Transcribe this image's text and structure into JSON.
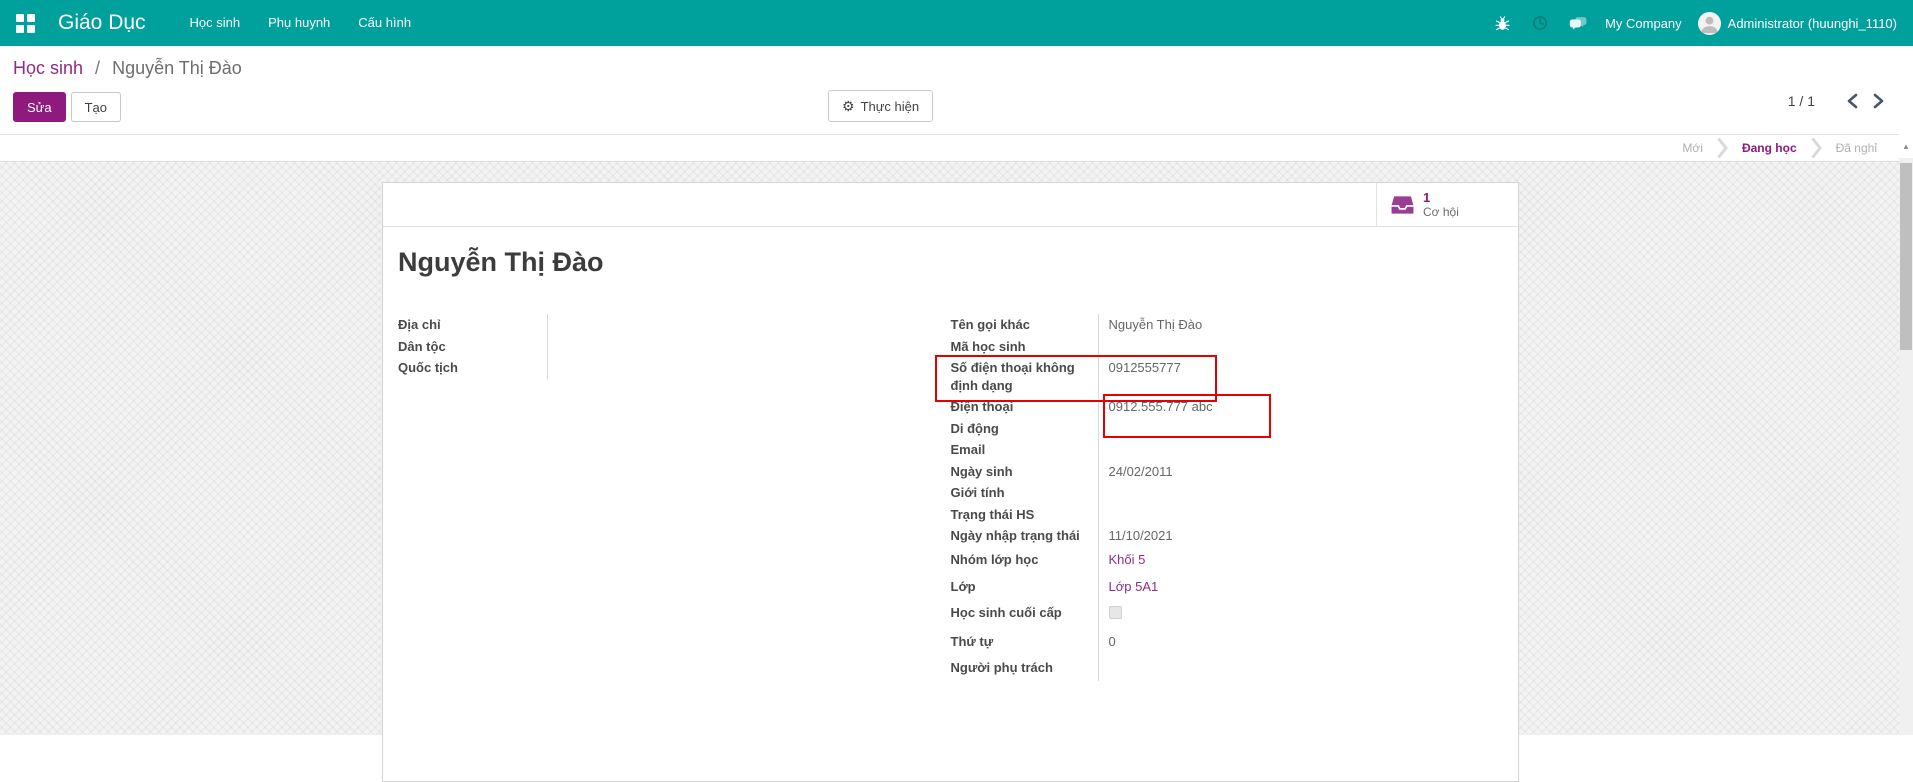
{
  "colors": {
    "teal": "#00a09d",
    "magenta": "#8e1a7e",
    "link": "#8f2b8a",
    "red": "#e60000"
  },
  "navbar": {
    "brand": "Giáo Dục",
    "menus": [
      {
        "label": "Học sinh"
      },
      {
        "label": "Phụ huynh"
      },
      {
        "label": "Cấu hình"
      }
    ],
    "icons": [
      "apps-grid-icon",
      "bug-icon",
      "clock-icon",
      "chat-icon",
      "avatar"
    ],
    "company": "My Company",
    "user": "Administrator (huunghi_1110)"
  },
  "breadcrumb": {
    "parent": "Học sinh",
    "separator": "/",
    "current": "Nguyễn Thị Đào"
  },
  "control_panel": {
    "edit_label": "Sửa",
    "create_label": "Tạo",
    "action_label": "Thực hiện",
    "action_icon": "gear-icon",
    "pager_value": "1 / 1"
  },
  "statusbar": {
    "steps": [
      {
        "label": "Mới",
        "active": false
      },
      {
        "label": "Đang học",
        "active": true
      },
      {
        "label": "Đã nghỉ",
        "active": false
      }
    ]
  },
  "sheet": {
    "button_box": {
      "icon": "opportunity-inbox-icon",
      "count": "1",
      "label": "Cơ hội"
    },
    "title": "Nguyễn Thị Đào",
    "left_group": [
      {
        "label": "Địa chỉ",
        "value": "",
        "type": "text"
      },
      {
        "label": "Dân tộc",
        "value": "",
        "type": "text"
      },
      {
        "label": "Quốc tịch",
        "value": "",
        "type": "text"
      }
    ],
    "right_group": [
      {
        "label": "Tên gọi khác",
        "value": "Nguyễn Thị Đào",
        "type": "text"
      },
      {
        "label": "Mã học sinh",
        "value": "",
        "type": "text"
      },
      {
        "label": "Số điện thoại không định dạng",
        "value": "0912555777",
        "type": "text",
        "highlight": "row"
      },
      {
        "label": "Điện thoại",
        "value": "0912.555.777 abc",
        "type": "text",
        "highlight": "value"
      },
      {
        "label": "Di động",
        "value": "",
        "type": "text"
      },
      {
        "label": "Email",
        "value": "",
        "type": "text"
      },
      {
        "label": "Ngày sinh",
        "value": "24/02/2011",
        "type": "text"
      },
      {
        "label": "Giới tính",
        "value": "",
        "type": "text"
      },
      {
        "label": "Trạng thái HS",
        "value": "",
        "type": "text"
      },
      {
        "label": "Ngày nhập trạng thái",
        "value": "11/10/2021",
        "type": "text"
      },
      {
        "label": "Nhóm lớp học",
        "value": "Khối 5",
        "type": "link"
      },
      {
        "label": "Lớp",
        "value": "Lớp 5A1",
        "type": "link"
      },
      {
        "label": "Học sinh cuối cấp",
        "value": "",
        "type": "checkbox"
      },
      {
        "label": "Thứ tự",
        "value": "0",
        "type": "text"
      },
      {
        "label": "Người phụ trách",
        "value": "",
        "type": "text"
      }
    ]
  }
}
